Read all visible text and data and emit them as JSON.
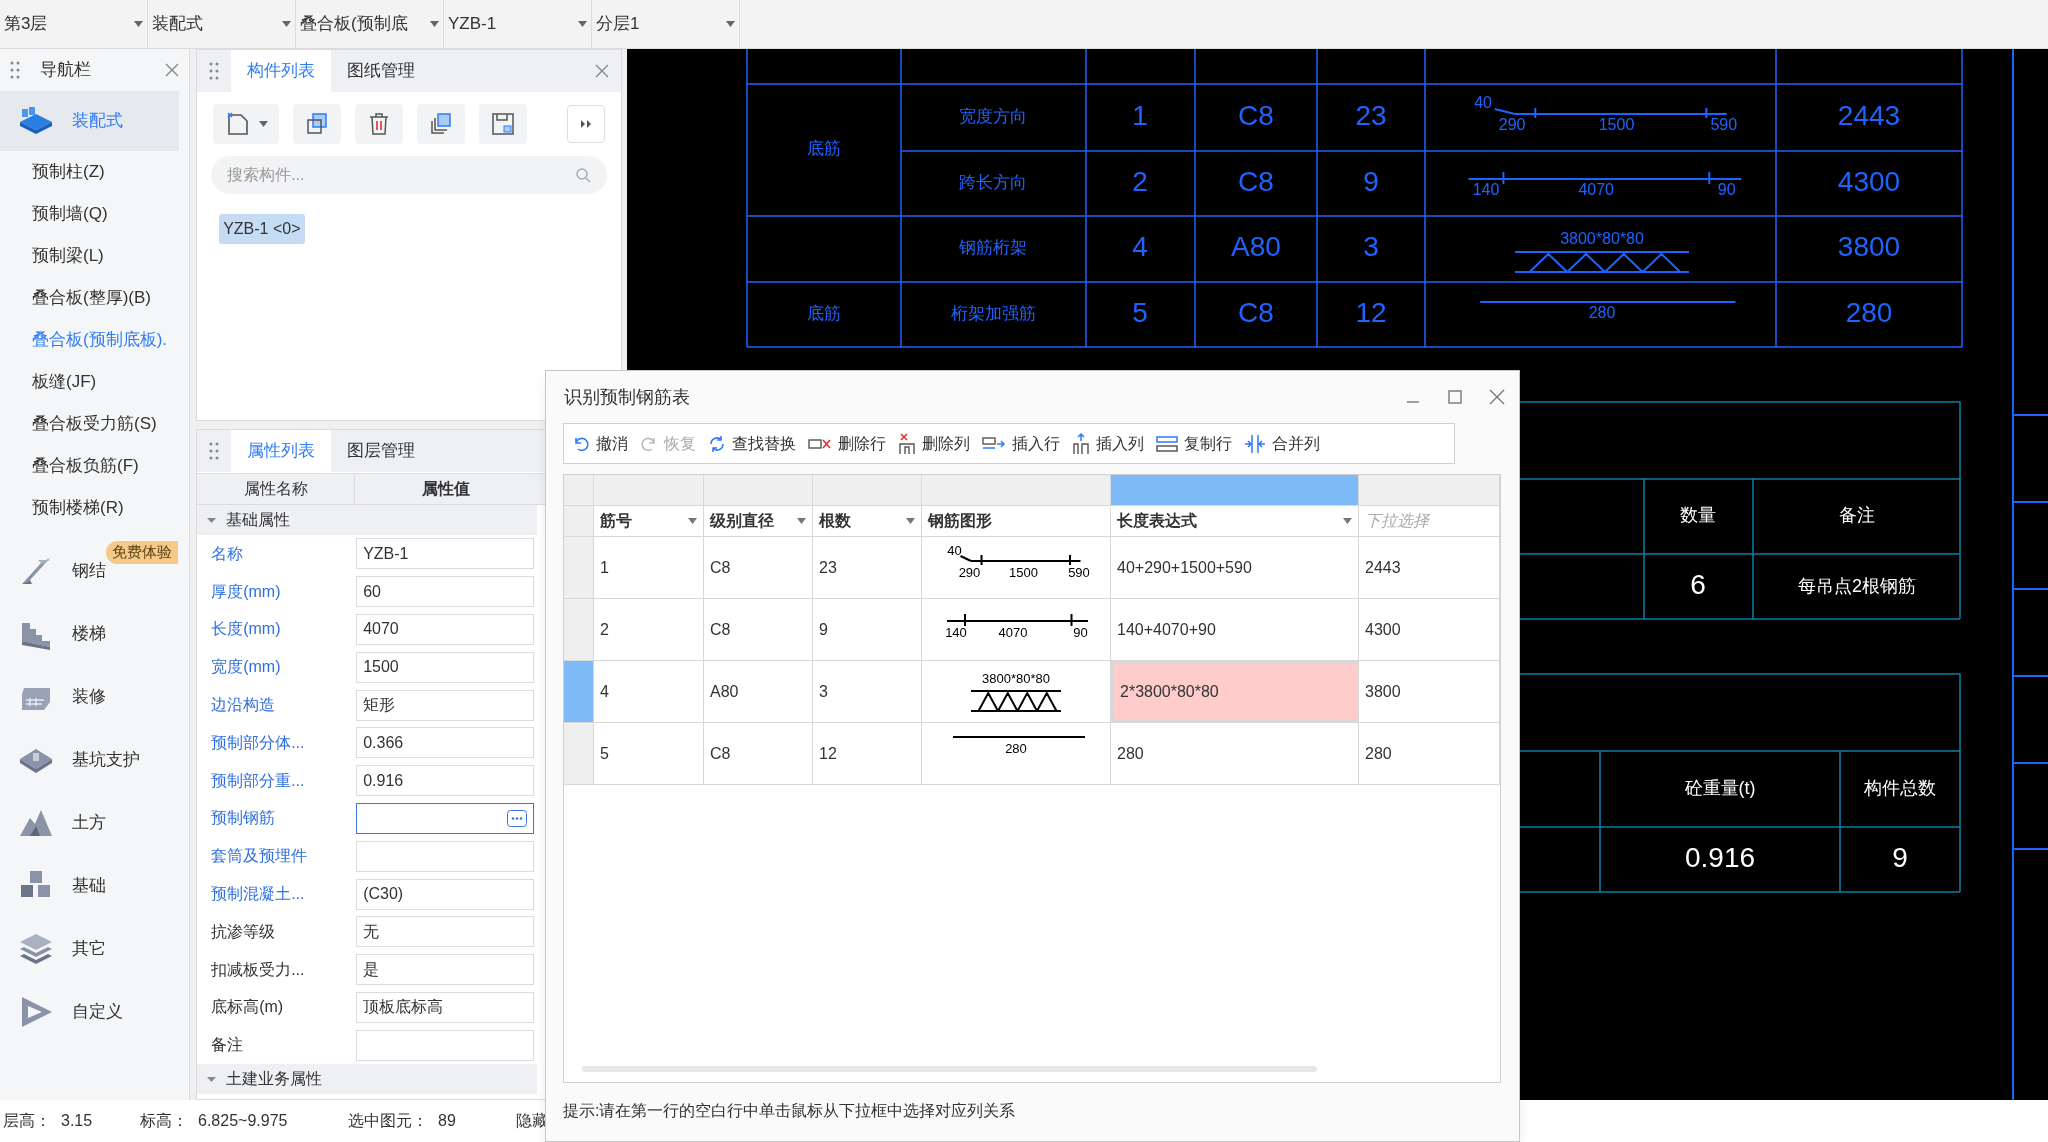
{
  "level_selectors": [
    "第3层",
    "装配式",
    "叠合板(预制底",
    "YZB-1",
    "分层1"
  ],
  "navigation": {
    "title": "导航栏",
    "category": {
      "label": "装配式",
      "selected": true
    },
    "items": [
      {
        "label": "预制柱(Z)",
        "selected": false
      },
      {
        "label": "预制墙(Q)",
        "selected": false
      },
      {
        "label": "预制梁(L)",
        "selected": false
      },
      {
        "label": "叠合板(整厚)(B)",
        "selected": false
      },
      {
        "label": "叠合板(预制底板).",
        "selected": true
      },
      {
        "label": "板缝(JF)",
        "selected": false
      },
      {
        "label": "叠合板受力筋(S)",
        "selected": false
      },
      {
        "label": "叠合板负筋(F)",
        "selected": false
      },
      {
        "label": "预制楼梯(R)",
        "selected": false
      }
    ],
    "modules": [
      {
        "label": "钢结",
        "badge": "免费体验"
      },
      {
        "label": "楼梯"
      },
      {
        "label": "装修"
      },
      {
        "label": "基坑支护"
      },
      {
        "label": "土方"
      },
      {
        "label": "基础"
      },
      {
        "label": "其它"
      },
      {
        "label": "自定义"
      }
    ]
  },
  "component_panel": {
    "tabs": [
      {
        "label": "构件列表",
        "selected": true
      },
      {
        "label": "图纸管理",
        "selected": false
      }
    ],
    "search": {
      "placeholder": "搜索构件..."
    },
    "components": [
      {
        "label": "YZB-1 <0>",
        "selected": true
      }
    ]
  },
  "property_panel": {
    "tabs": [
      {
        "label": "属性列表",
        "selected": true
      },
      {
        "label": "图层管理",
        "selected": false
      }
    ],
    "columns": [
      "属性名称",
      "属性值"
    ],
    "groups": [
      {
        "label": "基础属性",
        "expanded": true,
        "rows": [
          {
            "name": "名称",
            "value": "YZB-1",
            "public": true,
            "focused": false
          },
          {
            "name": "厚度(mm)",
            "value": "60",
            "public": true,
            "focused": false
          },
          {
            "name": "长度(mm)",
            "value": "4070",
            "public": true,
            "focused": false
          },
          {
            "name": "宽度(mm)",
            "value": "1500",
            "public": true,
            "focused": false
          },
          {
            "name": "边沿构造",
            "value": "矩形",
            "public": true,
            "focused": false
          },
          {
            "name": "预制部分体...",
            "value": "0.366",
            "public": true,
            "focused": false
          },
          {
            "name": "预制部分重...",
            "value": "0.916",
            "public": true,
            "focused": false
          },
          {
            "name": "预制钢筋",
            "public": true,
            "focused": true
          },
          {
            "name": "套筒及预埋件",
            "public": true,
            "focused": false
          },
          {
            "name": "预制混凝土...",
            "value": "(C30)",
            "public": true,
            "focused": false
          },
          {
            "name": "抗渗等级",
            "value": "无",
            "public": false,
            "focused": false
          },
          {
            "name": "扣减板受力...",
            "value": "是",
            "public": false,
            "focused": false
          },
          {
            "name": "底标高(m)",
            "value": "顶板底标高",
            "public": false,
            "focused": false
          },
          {
            "name": "备注",
            "public": false,
            "focused": false
          }
        ]
      },
      {
        "label": "土建业务属性",
        "expanded": true
      }
    ]
  },
  "status_bar": [
    {
      "label": "层高：",
      "value": "3.15"
    },
    {
      "label": "标高：",
      "value": "6.825~9.975"
    },
    {
      "label": "选中图元：",
      "value": "89"
    },
    {
      "label": "隐藏"
    }
  ],
  "drawing": {
    "rebar_table": {
      "groups": [
        {
          "position": "底筋",
          "rows": [
            {
              "type": "宽度方向",
              "no": "1",
              "grade": "C8",
              "count": "23",
              "shape": {
                "kind": "hook",
                "labels": [
                  "40",
                  "290",
                  "1500",
                  "590"
                ]
              },
              "length": "2443"
            },
            {
              "type": "跨长方向",
              "no": "2",
              "grade": "C8",
              "count": "9",
              "shape": {
                "kind": "straight",
                "labels": [
                  "140",
                  "4070",
                  "90"
                ]
              },
              "length": "4300"
            }
          ]
        },
        {
          "rows": [
            {
              "type": "钢筋桁架",
              "no": "4",
              "grade": "A80",
              "count": "3",
              "shape": {
                "kind": "truss",
                "labels": [
                  "3800*80*80"
                ]
              },
              "length": "3800"
            }
          ]
        },
        {
          "position": "底筋",
          "rows": [
            {
              "type": "桁架加强筋",
              "no": "5",
              "grade": "C8",
              "count": "12",
              "shape": {
                "kind": "line",
                "labels": [
                  "280"
                ]
              },
              "length": "280"
            }
          ]
        }
      ]
    },
    "lifting_table": {
      "columns": [
        "数量",
        "备注"
      ],
      "row": [
        "6",
        "每吊点2根钢筋"
      ]
    },
    "summary_table": {
      "columns": [
        "砼重量(t)",
        "构件总数"
      ],
      "row": [
        "0.916",
        "9"
      ]
    }
  },
  "dialog": {
    "title": "识别预制钢筋表",
    "toolbar": [
      {
        "label": "撤消",
        "disabled": false
      },
      {
        "label": "恢复",
        "disabled": true
      },
      {
        "label": "查找替换",
        "disabled": false
      },
      {
        "label": "删除行",
        "disabled": false
      },
      {
        "label": "删除列",
        "disabled": false
      },
      {
        "label": "插入行",
        "disabled": false
      },
      {
        "label": "插入列",
        "disabled": false
      },
      {
        "label": "复制行",
        "disabled": false
      },
      {
        "label": "合并列",
        "disabled": false
      }
    ],
    "columns": [
      {
        "label": "筋号",
        "dropdown": true,
        "selected": false
      },
      {
        "label": "级别直径",
        "dropdown": true,
        "selected": false
      },
      {
        "label": "根数",
        "dropdown": true,
        "selected": false
      },
      {
        "label": "钢筋图形",
        "dropdown": false,
        "selected": false
      },
      {
        "label": "长度表达式",
        "dropdown": true,
        "selected": true
      },
      {
        "placeholder": "下拉选择",
        "dropdown": false,
        "selected": false
      }
    ],
    "rows": [
      {
        "no": "1",
        "grade": "C8",
        "count": "23",
        "shape": {
          "kind": "hook",
          "labels": [
            "40",
            "290",
            "1500",
            "590"
          ]
        },
        "expression": "40+290+1500+590",
        "length": "2443",
        "selected": false,
        "active": false
      },
      {
        "no": "2",
        "grade": "C8",
        "count": "9",
        "shape": {
          "kind": "straight",
          "labels": [
            "140",
            "4070",
            "90"
          ]
        },
        "expression": "140+4070+90",
        "length": "4300",
        "selected": false,
        "active": false
      },
      {
        "no": "4",
        "grade": "A80",
        "count": "3",
        "shape": {
          "kind": "truss",
          "labels": [
            "3800*80*80"
          ]
        },
        "expression": "2*3800*80*80",
        "length": "3800",
        "selected": true,
        "active": true
      },
      {
        "no": "5",
        "grade": "C8",
        "count": "12",
        "shape": {
          "kind": "line",
          "labels": [
            "280"
          ]
        },
        "expression": "280",
        "length": "280",
        "selected": false,
        "active": false
      }
    ],
    "hint": "提示:请在第一行的空白行中单击鼠标从下拉框中选择对应列关系"
  }
}
